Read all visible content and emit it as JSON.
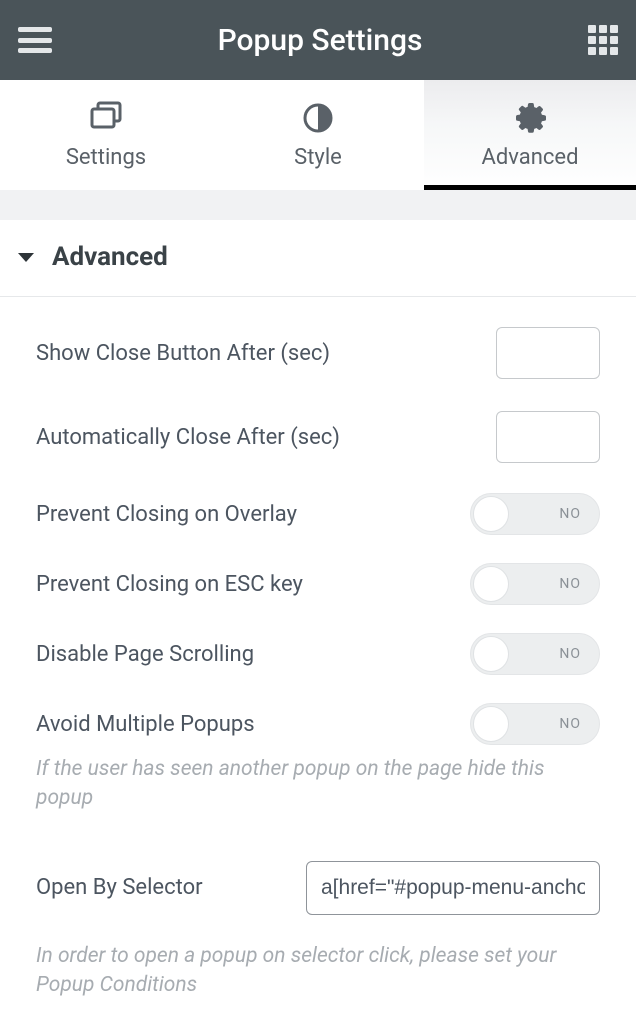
{
  "header": {
    "title": "Popup Settings"
  },
  "tabs": {
    "settings": "Settings",
    "style": "Style",
    "advanced": "Advanced"
  },
  "section": {
    "title": "Advanced"
  },
  "fields": {
    "show_close_after": {
      "label": "Show Close Button After (sec)",
      "value": ""
    },
    "auto_close_after": {
      "label": "Automatically Close After (sec)",
      "value": ""
    },
    "prevent_overlay": {
      "label": "Prevent Closing on Overlay",
      "state": "NO"
    },
    "prevent_esc": {
      "label": "Prevent Closing on ESC key",
      "state": "NO"
    },
    "disable_scroll": {
      "label": "Disable Page Scrolling",
      "state": "NO"
    },
    "avoid_multiple": {
      "label": "Avoid Multiple Popups",
      "state": "NO",
      "desc": "If the user has seen another popup on the page hide this popup"
    },
    "open_by_selector": {
      "label": "Open By Selector",
      "value": "a[href=\"#popup-menu-anchor\"]",
      "desc": "In order to open a popup on selector click, please set your Popup Conditions"
    }
  }
}
